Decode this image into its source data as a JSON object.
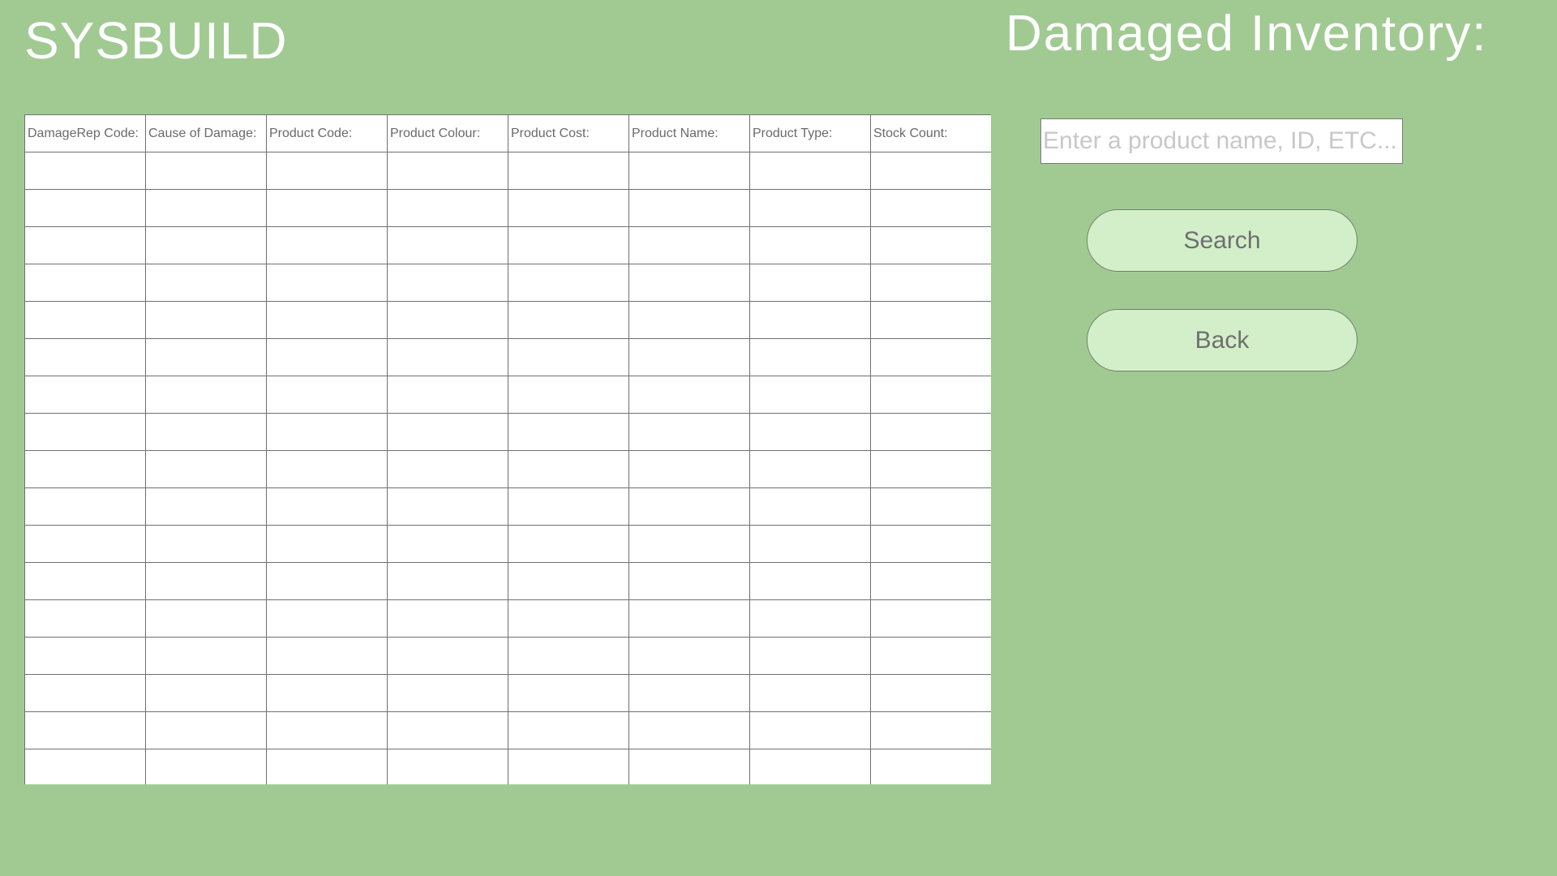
{
  "header": {
    "app_title": "SYSBUILD",
    "page_title": "Damaged Inventory:"
  },
  "table": {
    "columns": [
      "DamageRep Code:",
      "Cause of Damage:",
      "Product Code:",
      "Product Colour:",
      "Product Cost:",
      "Product Name:",
      "Product Type:",
      "Stock Count:"
    ],
    "rows": [
      [
        "",
        "",
        "",
        "",
        "",
        "",
        "",
        ""
      ],
      [
        "",
        "",
        "",
        "",
        "",
        "",
        "",
        ""
      ],
      [
        "",
        "",
        "",
        "",
        "",
        "",
        "",
        ""
      ],
      [
        "",
        "",
        "",
        "",
        "",
        "",
        "",
        ""
      ],
      [
        "",
        "",
        "",
        "",
        "",
        "",
        "",
        ""
      ],
      [
        "",
        "",
        "",
        "",
        "",
        "",
        "",
        ""
      ],
      [
        "",
        "",
        "",
        "",
        "",
        "",
        "",
        ""
      ],
      [
        "",
        "",
        "",
        "",
        "",
        "",
        "",
        ""
      ],
      [
        "",
        "",
        "",
        "",
        "",
        "",
        "",
        ""
      ],
      [
        "",
        "",
        "",
        "",
        "",
        "",
        "",
        ""
      ],
      [
        "",
        "",
        "",
        "",
        "",
        "",
        "",
        ""
      ],
      [
        "",
        "",
        "",
        "",
        "",
        "",
        "",
        ""
      ],
      [
        "",
        "",
        "",
        "",
        "",
        "",
        "",
        ""
      ],
      [
        "",
        "",
        "",
        "",
        "",
        "",
        "",
        ""
      ],
      [
        "",
        "",
        "",
        "",
        "",
        "",
        "",
        ""
      ],
      [
        "",
        "",
        "",
        "",
        "",
        "",
        "",
        ""
      ],
      [
        "",
        "",
        "",
        "",
        "",
        "",
        "",
        ""
      ]
    ]
  },
  "search": {
    "value": "",
    "placeholder": "Enter a product name, ID, ETC...",
    "button_label": "Search"
  },
  "nav": {
    "back_label": "Back"
  },
  "colors": {
    "background": "#a1ca93",
    "button_fill": "#d3efc9",
    "title_text": "#ffffff"
  }
}
